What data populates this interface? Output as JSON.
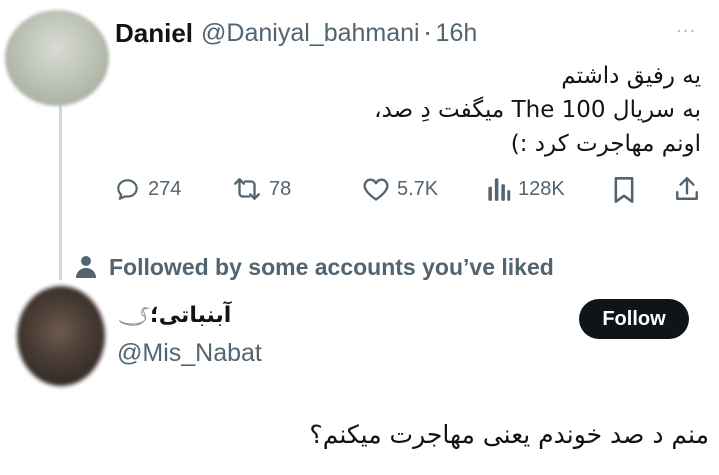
{
  "tweet": {
    "author": {
      "name": "Daniel",
      "handle": "@Daniyal_bahmani",
      "separator": "·",
      "time": "16h"
    },
    "more_label": "···",
    "text_lines": [
      "یه رفیق داشتم",
      "به سریال The 100 میگفت دِ صد،",
      "اونم مهاجرت کرد :)"
    ],
    "actions": {
      "replies": "274",
      "retweets": "78",
      "likes": "5.7K",
      "views": "128K"
    },
    "icons": [
      "reply-icon",
      "retweet-icon",
      "like-icon",
      "views-icon",
      "bookmark-icon",
      "share-icon",
      "more-icon"
    ]
  },
  "social_context": {
    "icon": "person-icon",
    "text": "Followed by some accounts you’ve liked"
  },
  "user2": {
    "name": "آبنباتی؛",
    "name_icon": "swan-icon",
    "handle": "@Mis_Nabat",
    "follow_label": "Follow"
  },
  "bottom_text": "منم د صد خوندم یعنی مهاجرت میکنم؟",
  "colors": {
    "text_primary": "#0f1419",
    "text_secondary": "#536471",
    "thread_line": "#cfd9de",
    "follow_bg": "#0f1419",
    "follow_text": "#ffffff"
  }
}
